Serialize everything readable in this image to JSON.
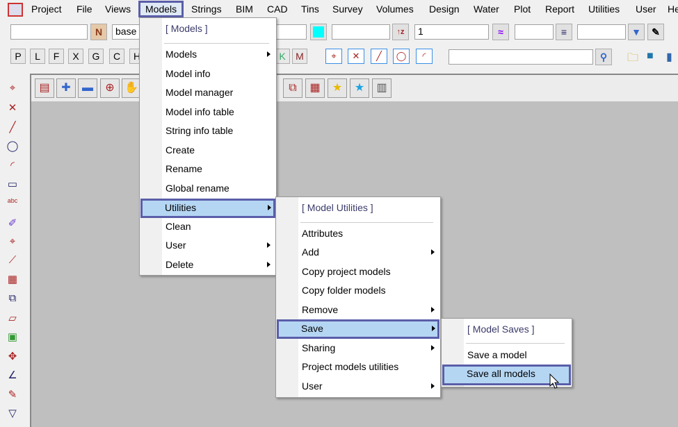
{
  "menubar": {
    "items": [
      "Project",
      "File",
      "Views",
      "Models",
      "Strings",
      "BIM",
      "CAD",
      "Tins",
      "Survey",
      "Volumes",
      "Design",
      "Water",
      "Plot",
      "Report",
      "Utilities",
      "User",
      "He"
    ],
    "active": "Models"
  },
  "toolbar1": {
    "field1": "",
    "name_button": "N",
    "field2": "base",
    "color_swatch": "#00ffff",
    "field3": "",
    "field4": "1",
    "field5": "",
    "field6": ""
  },
  "toolbar2": {
    "buttons": [
      "P",
      "L",
      "F",
      "X",
      "G",
      "C",
      "H",
      "K",
      "M"
    ],
    "search_value": ""
  },
  "models_menu": {
    "header": "[ Models ]",
    "items": [
      {
        "label": "Models",
        "submenu": true
      },
      {
        "label": "Model info"
      },
      {
        "label": "Model manager"
      },
      {
        "label": "Model info table"
      },
      {
        "label": "String info table"
      },
      {
        "label": "Create"
      },
      {
        "label": "Rename"
      },
      {
        "label": "Global rename"
      },
      {
        "label": "Utilities",
        "submenu": true,
        "highlighted": true
      },
      {
        "label": "Clean"
      },
      {
        "label": "User",
        "submenu": true
      },
      {
        "label": "Delete",
        "submenu": true
      }
    ]
  },
  "utilities_menu": {
    "header": "[ Model Utilities ]",
    "items": [
      {
        "label": "Attributes"
      },
      {
        "label": "Add",
        "submenu": true
      },
      {
        "label": "Copy project models"
      },
      {
        "label": "Copy folder models"
      },
      {
        "label": "Remove",
        "submenu": true
      },
      {
        "label": "Save",
        "submenu": true,
        "highlighted": true
      },
      {
        "label": "Sharing",
        "submenu": true
      },
      {
        "label": "Project models utilities"
      },
      {
        "label": "User",
        "submenu": true
      }
    ]
  },
  "save_menu": {
    "header": "[ Model Saves ]",
    "items": [
      {
        "label": "Save a model"
      },
      {
        "label": "Save all models",
        "highlighted": true
      }
    ]
  },
  "colors": {
    "highlight": "#b5d6f3",
    "highlight_border": "#5a5ea8",
    "canvas": "#bfbfbf"
  }
}
